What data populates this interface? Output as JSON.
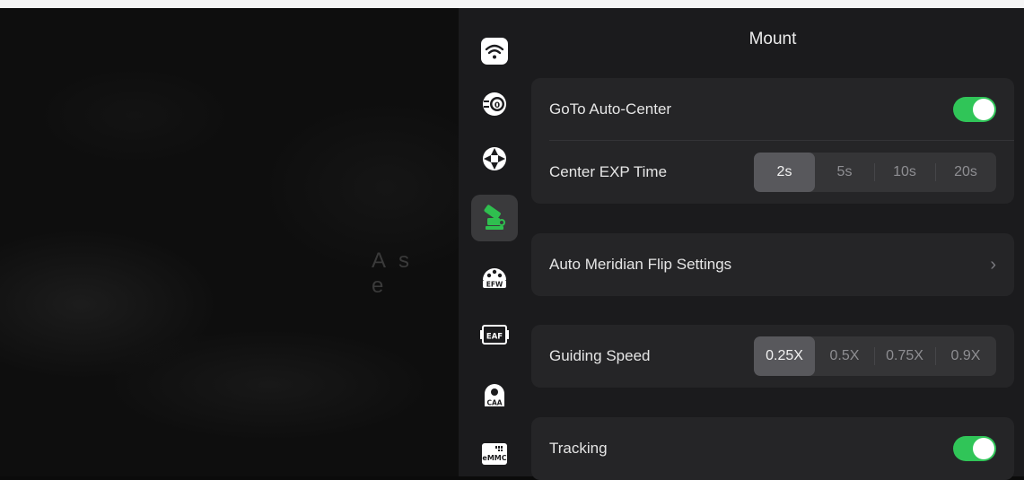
{
  "background": {
    "watermark": "As e"
  },
  "header": {
    "title": "Mount"
  },
  "rail": [
    {
      "icon": "wifi-icon",
      "active": false
    },
    {
      "icon": "camera-icon",
      "active": false
    },
    {
      "icon": "guide-crosshair-icon",
      "active": false
    },
    {
      "icon": "mount-icon",
      "active": true
    },
    {
      "icon": "filter-wheel-icon",
      "label": "EFW",
      "active": false
    },
    {
      "icon": "focuser-icon",
      "label": "EAF",
      "active": false
    },
    {
      "icon": "rotator-icon",
      "label": "CAA",
      "active": false
    },
    {
      "icon": "storage-icon",
      "label": "eMMC",
      "active": false
    }
  ],
  "settings": {
    "goto_auto_center": {
      "label": "GoTo Auto-Center",
      "on": true
    },
    "center_exp_time": {
      "label": "Center EXP Time",
      "options": [
        "2s",
        "5s",
        "10s",
        "20s"
      ],
      "selected": "2s"
    },
    "auto_meridian_flip": {
      "label": "Auto Meridian Flip Settings",
      "chevron": "›"
    },
    "guiding_speed": {
      "label": "Guiding Speed",
      "options": [
        "0.25X",
        "0.5X",
        "0.75X",
        "0.9X"
      ],
      "selected": "0.25X"
    },
    "tracking": {
      "label": "Tracking",
      "on": true
    }
  },
  "colors": {
    "toggle_on": "#30c558",
    "accent_green": "#2fbf4f",
    "panel": "#1b1b1d",
    "card": "#252527"
  }
}
